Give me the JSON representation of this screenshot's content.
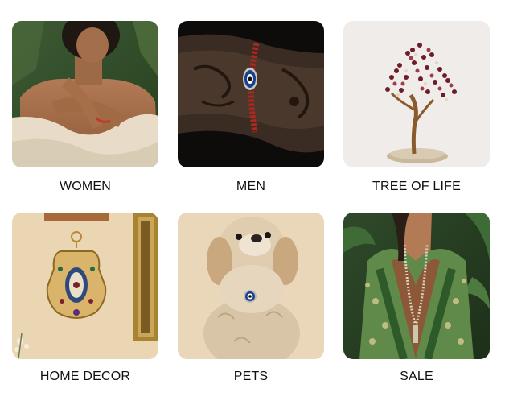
{
  "categories": [
    {
      "label": "WOMEN",
      "image": "woman-in-cream-wrap-with-bracelet"
    },
    {
      "label": "MEN",
      "image": "tattooed-wrist-with-evil-eye-bracelet"
    },
    {
      "label": "TREE OF LIFE",
      "image": "gemstone-tree-on-stone-base"
    },
    {
      "label": "HOME DECOR",
      "image": "hamsa-wall-hanging"
    },
    {
      "label": "PETS",
      "image": "dog-with-evil-eye-collar"
    },
    {
      "label": "SALE",
      "image": "woman-in-green-kimono"
    }
  ],
  "colors": {
    "page_background": "#ffffff",
    "label_text": "#111111"
  }
}
